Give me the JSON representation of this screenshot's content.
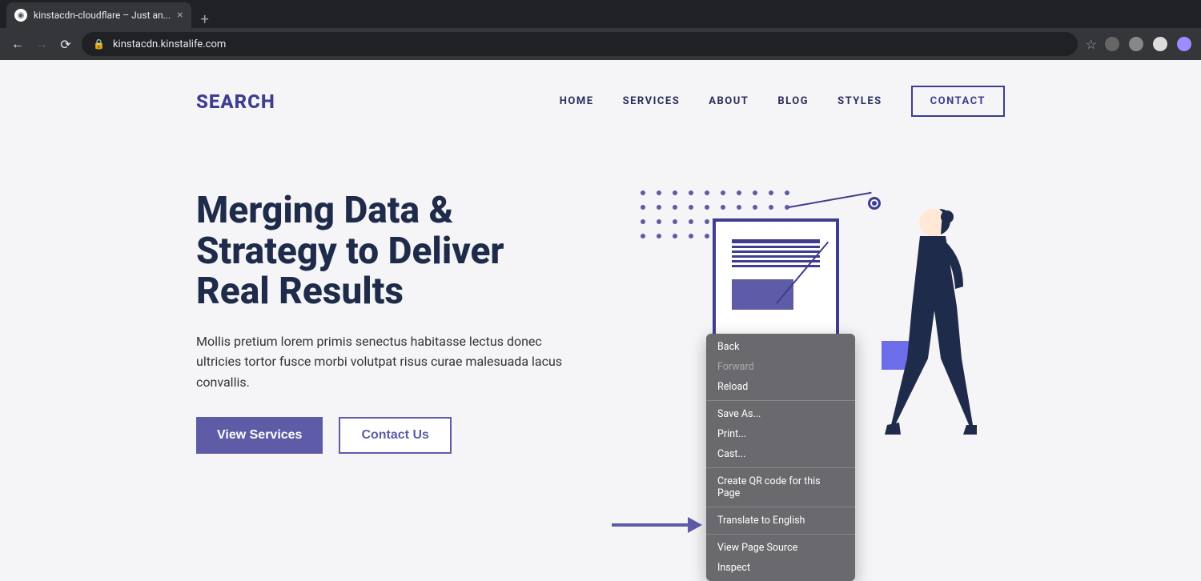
{
  "browser": {
    "tab_title": "kinstacdn-cloudflare – Just an...",
    "url": "kinstacdn.kinstalife.com"
  },
  "site": {
    "logo": "SEARCH",
    "nav": [
      "HOME",
      "SERVICES",
      "ABOUT",
      "BLOG",
      "STYLES"
    ],
    "nav_cta": "CONTACT"
  },
  "hero": {
    "title": "Merging Data & Strategy to Deliver Real Results",
    "desc": "Mollis pretium lorem primis senectus habitasse lectus donec ultricies tortor fusce morbi volutpat risus curae malesuada lacus convallis.",
    "btn_primary": "View Services",
    "btn_secondary": "Contact Us"
  },
  "context_menu": {
    "back": "Back",
    "forward": "Forward",
    "reload": "Reload",
    "save_as": "Save As...",
    "print": "Print...",
    "cast": "Cast...",
    "qr": "Create QR code for this Page",
    "translate": "Translate to English",
    "view_source": "View Page Source",
    "inspect": "Inspect"
  }
}
